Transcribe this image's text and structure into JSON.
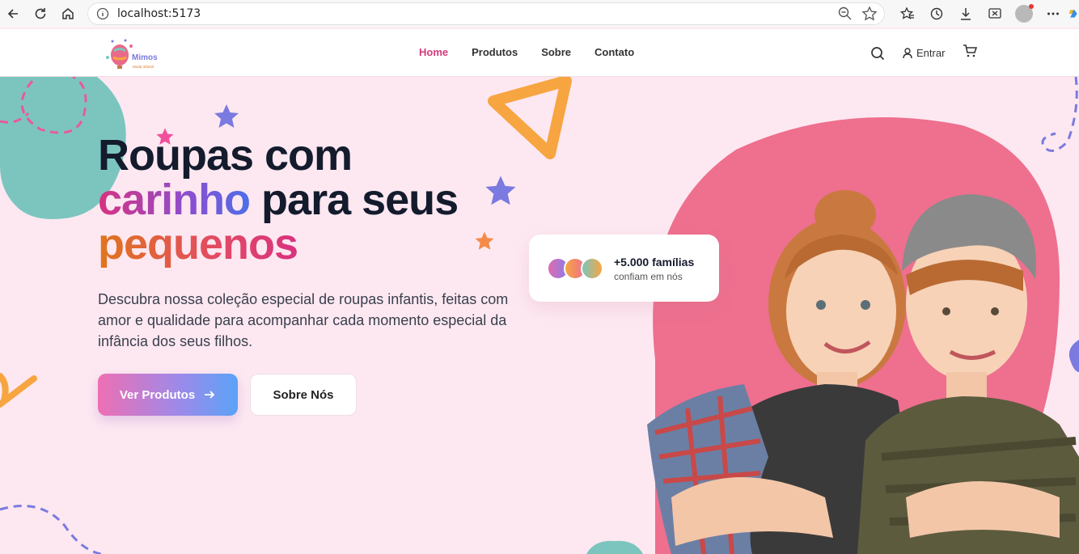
{
  "browser": {
    "url": "localhost:5173"
  },
  "header": {
    "logo_text": "Mimos",
    "logo_sub": "Moda Infantil",
    "menu": [
      {
        "label": "Home",
        "active": true
      },
      {
        "label": "Produtos",
        "active": false
      },
      {
        "label": "Sobre",
        "active": false
      },
      {
        "label": "Contato",
        "active": false
      }
    ],
    "login_label": "Entrar",
    "icons": [
      "search-icon",
      "user-icon",
      "cart-icon"
    ]
  },
  "hero": {
    "title_line1": "Roupas com",
    "title_highlight1": "carinho",
    "title_line2_rest": " para seus",
    "title_highlight2": "pequenos",
    "description": "Descubra nossa coleção especial de roupas infantis, feitas com amor e qualidade para acompanhar cada momento especial da infância dos seus filhos.",
    "primary_button": "Ver Produtos",
    "secondary_button": "Sobre Nós",
    "badge_title": "+5.000 famílias",
    "badge_sub": "confiam em nós"
  },
  "colors": {
    "accent_pink": "#d63a78",
    "hero_bg": "#fde8f1",
    "blob_pink": "#ee6f8e",
    "teal": "#7cc5bf",
    "orange": "#f7a541",
    "purple_star": "#7b7ae0"
  }
}
